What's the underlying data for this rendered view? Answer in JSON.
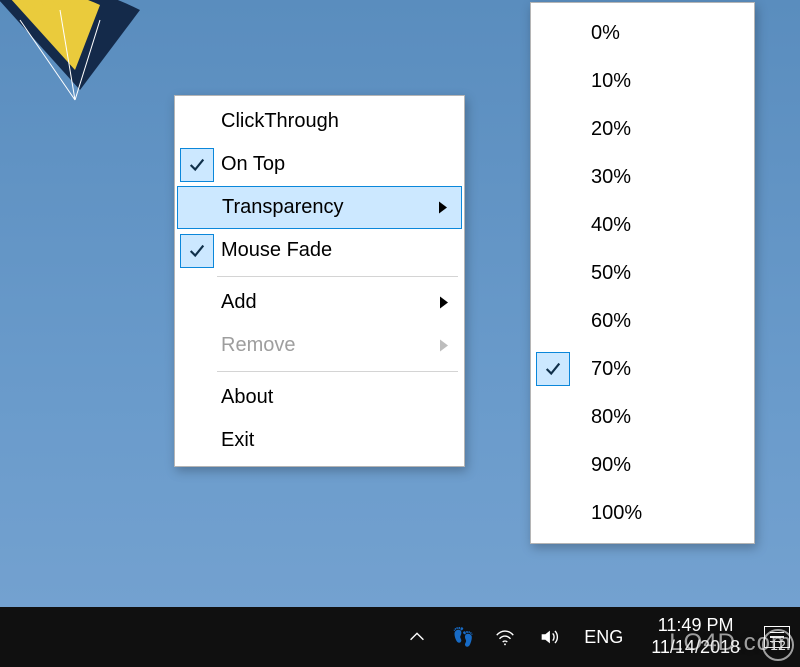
{
  "menu": {
    "clickthrough": "ClickThrough",
    "ontop": "On Top",
    "transparency": "Transparency",
    "mousefade": "Mouse Fade",
    "add": "Add",
    "remove": "Remove",
    "about": "About",
    "exit": "Exit"
  },
  "submenu": {
    "p0": "0%",
    "p10": "10%",
    "p20": "20%",
    "p30": "30%",
    "p40": "40%",
    "p50": "50%",
    "p60": "60%",
    "p70": "70%",
    "p80": "80%",
    "p90": "90%",
    "p100": "100%"
  },
  "taskbar": {
    "lang": "ENG",
    "time": "11:49 PM",
    "date": "11/14/2018"
  },
  "watermark": "LO4D.com"
}
